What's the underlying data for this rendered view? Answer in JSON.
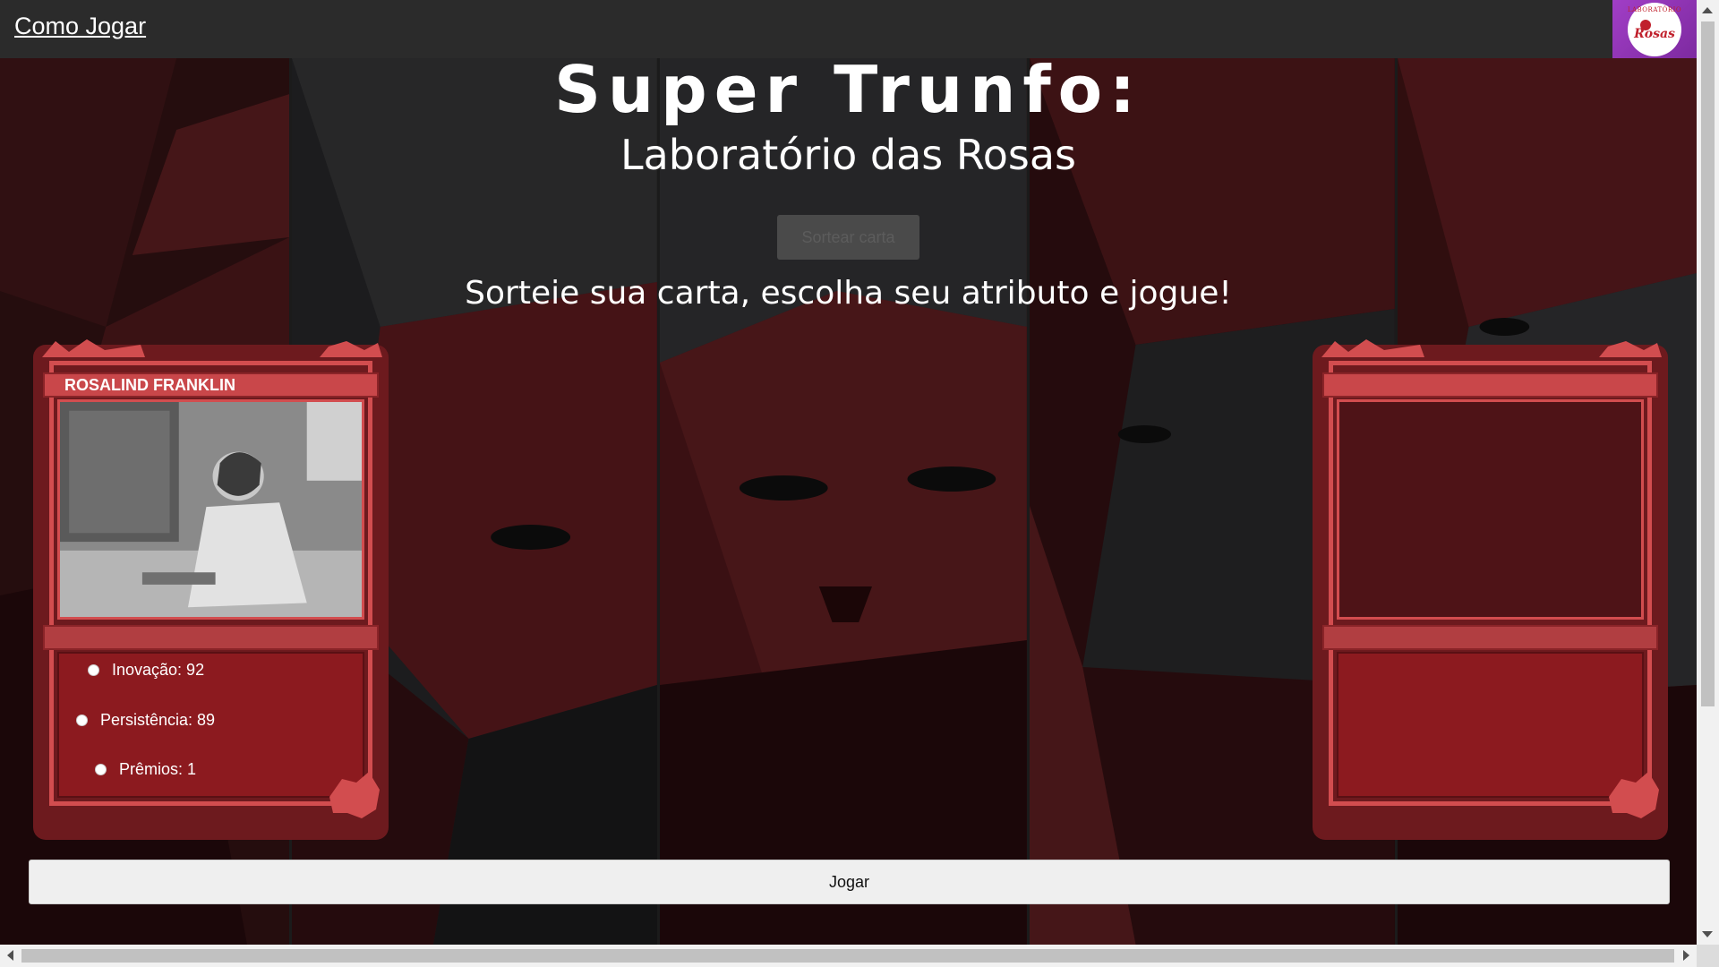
{
  "nav": {
    "how_to_play": "Como Jogar",
    "logo": {
      "top_text": "LABORATÓRIO",
      "mid_text": "Rosas"
    }
  },
  "header": {
    "title": "Super Trunfo:",
    "subtitle": "Laboratório das Rosas",
    "draw_button": "Sortear carta",
    "instruction": "Sorteie sua carta, escolha seu atributo e jogue!"
  },
  "player_card": {
    "name": "ROSALIND FRANKLIN",
    "attributes": [
      {
        "label": "Inovação: 92"
      },
      {
        "label": "Persistência: 89"
      },
      {
        "label": "Prêmios: 1"
      }
    ]
  },
  "opponent_card": {
    "name": "",
    "attributes": []
  },
  "actions": {
    "play_button": "Jogar"
  },
  "colors": {
    "card_red": "#8c1a1f",
    "card_accent": "#d24d4f",
    "topbar": "#2b2b2b",
    "logo_purple": "#a13ec6"
  }
}
